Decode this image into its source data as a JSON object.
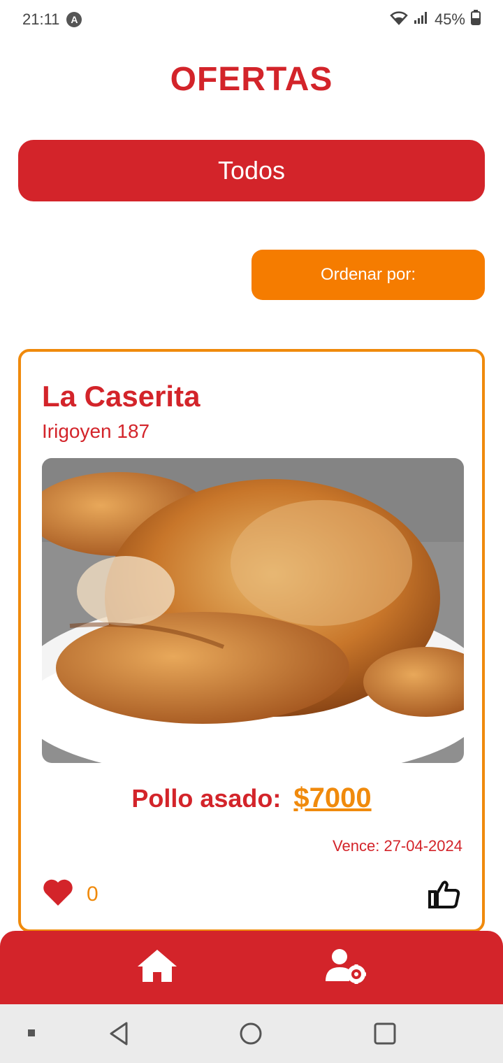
{
  "status_bar": {
    "time": "21:11",
    "app_badge": "A",
    "battery_percent": "45%",
    "icons": [
      "wifi-icon",
      "signal-icon",
      "battery-icon"
    ]
  },
  "page": {
    "title": "OFERTAS"
  },
  "filter": {
    "label": "Todos"
  },
  "sort": {
    "label": "Ordenar por:"
  },
  "offer": {
    "store_name": "La Caserita",
    "address": "Irigoyen 187",
    "image_icon": "roast-chicken-photo",
    "product_name": "Pollo asado:",
    "price": "$7000",
    "expiry_label": "Vence:",
    "expiry_date": "27-04-2024",
    "likes": "0"
  },
  "bottom_nav": {
    "items": [
      {
        "icon": "home-icon"
      },
      {
        "icon": "user-settings-icon"
      }
    ]
  },
  "colors": {
    "primary": "#d3242a",
    "accent": "#f57c00",
    "card_border": "#f08a0c",
    "system_nav_bg": "#ebebeb"
  }
}
